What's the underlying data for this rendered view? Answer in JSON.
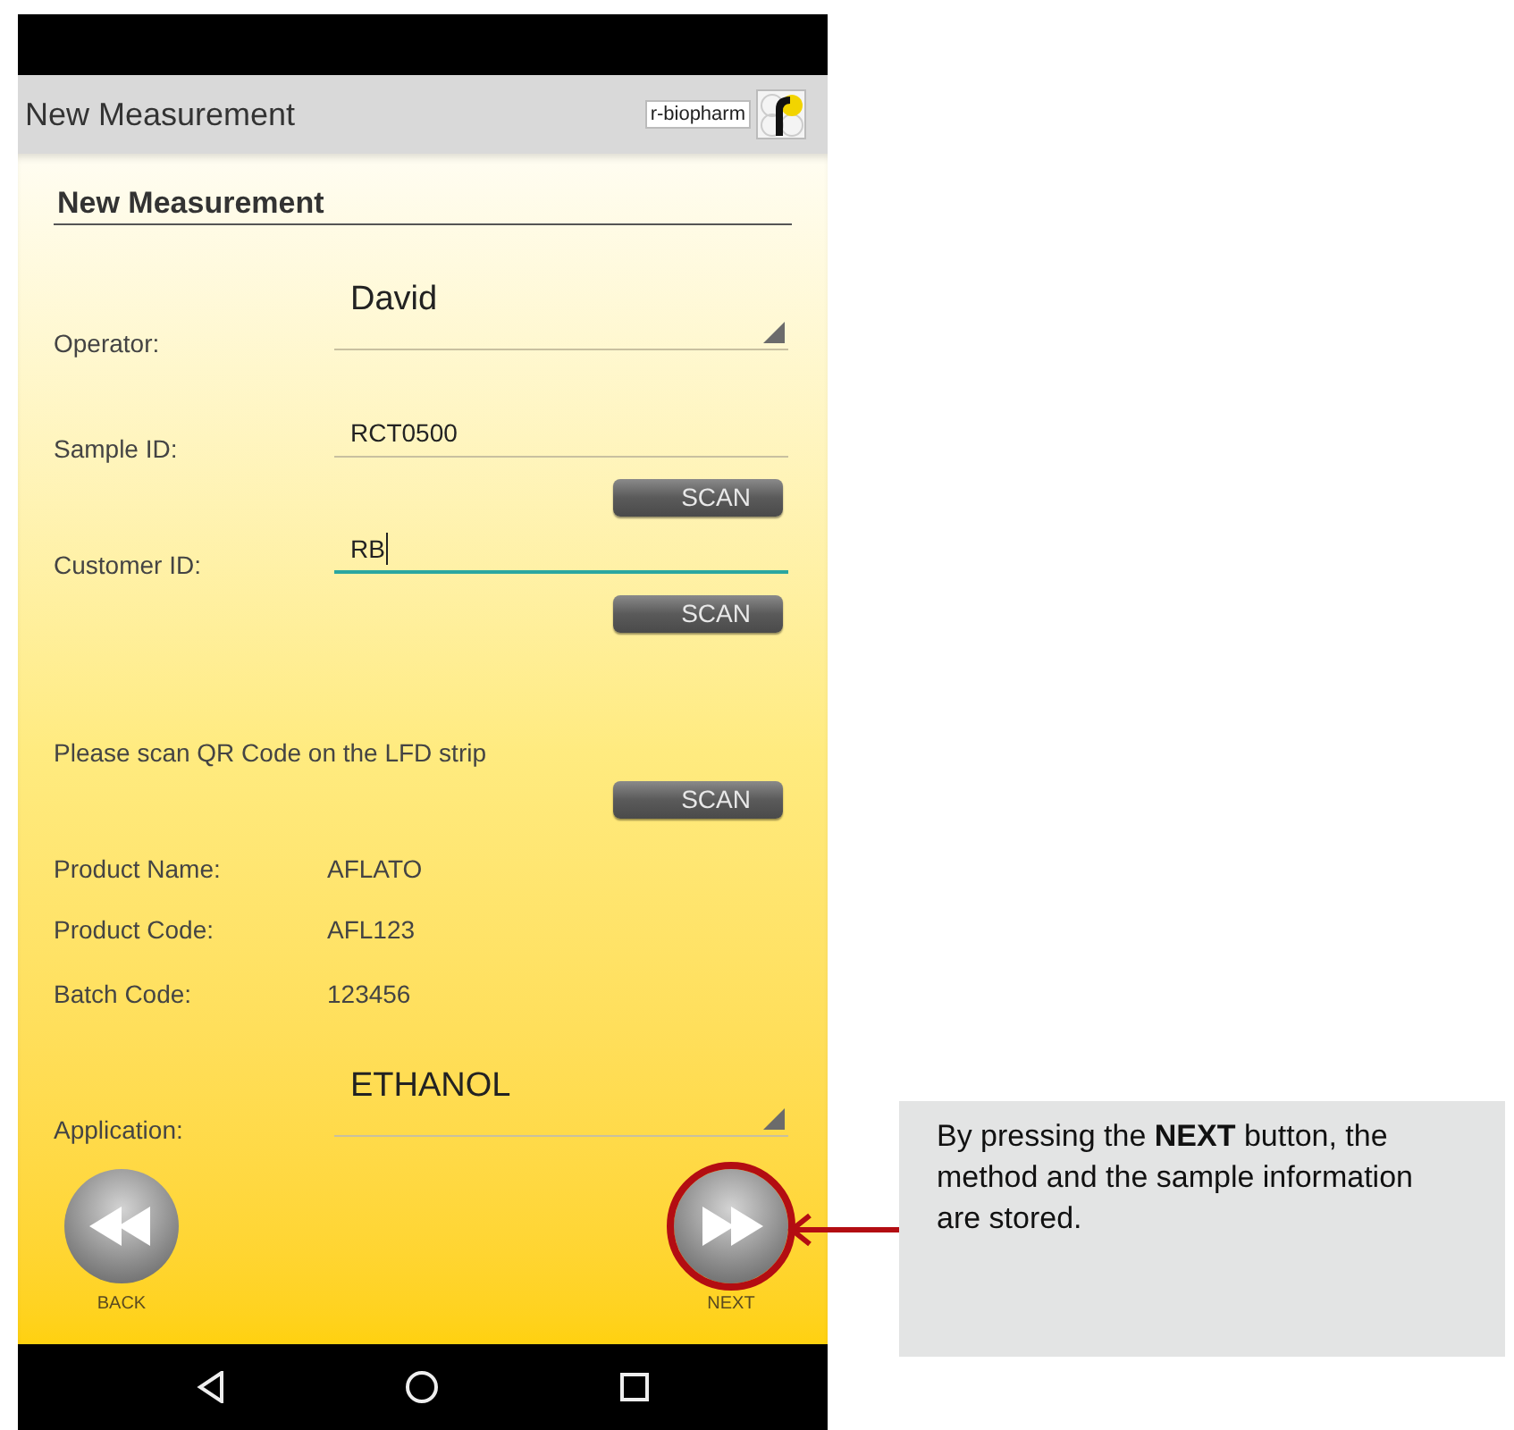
{
  "app_bar": {
    "title": "New Measurement",
    "logo_text": "r-biopharm"
  },
  "heading": "New Measurement",
  "fields": [
    {
      "kind": "dropdown",
      "label": "Operator:",
      "value": "David"
    },
    {
      "kind": "text",
      "label": "Sample ID:",
      "value": "RCT0500",
      "focused": false,
      "scan_button": "SCAN"
    },
    {
      "kind": "text",
      "label": "Customer ID:",
      "value": "RB",
      "focused": true,
      "scan_button": "SCAN"
    }
  ],
  "qr_prompt": "Please scan QR Code on the LFD strip",
  "qr_scan_button": "SCAN",
  "info": [
    {
      "label": "Product Name:",
      "value": "AFLATO"
    },
    {
      "label": "Product Code:",
      "value": "AFL123"
    },
    {
      "label": "Batch Code:",
      "value": "123456"
    }
  ],
  "application": {
    "label": "Application:",
    "value": "ETHANOL"
  },
  "nav_buttons": [
    {
      "kind": "back",
      "label": "BACK",
      "highlighted": false
    },
    {
      "kind": "next",
      "label": "NEXT",
      "highlighted": true
    }
  ],
  "callout": "By pressing the **NEXT** button, the method and the sample information are stored."
}
